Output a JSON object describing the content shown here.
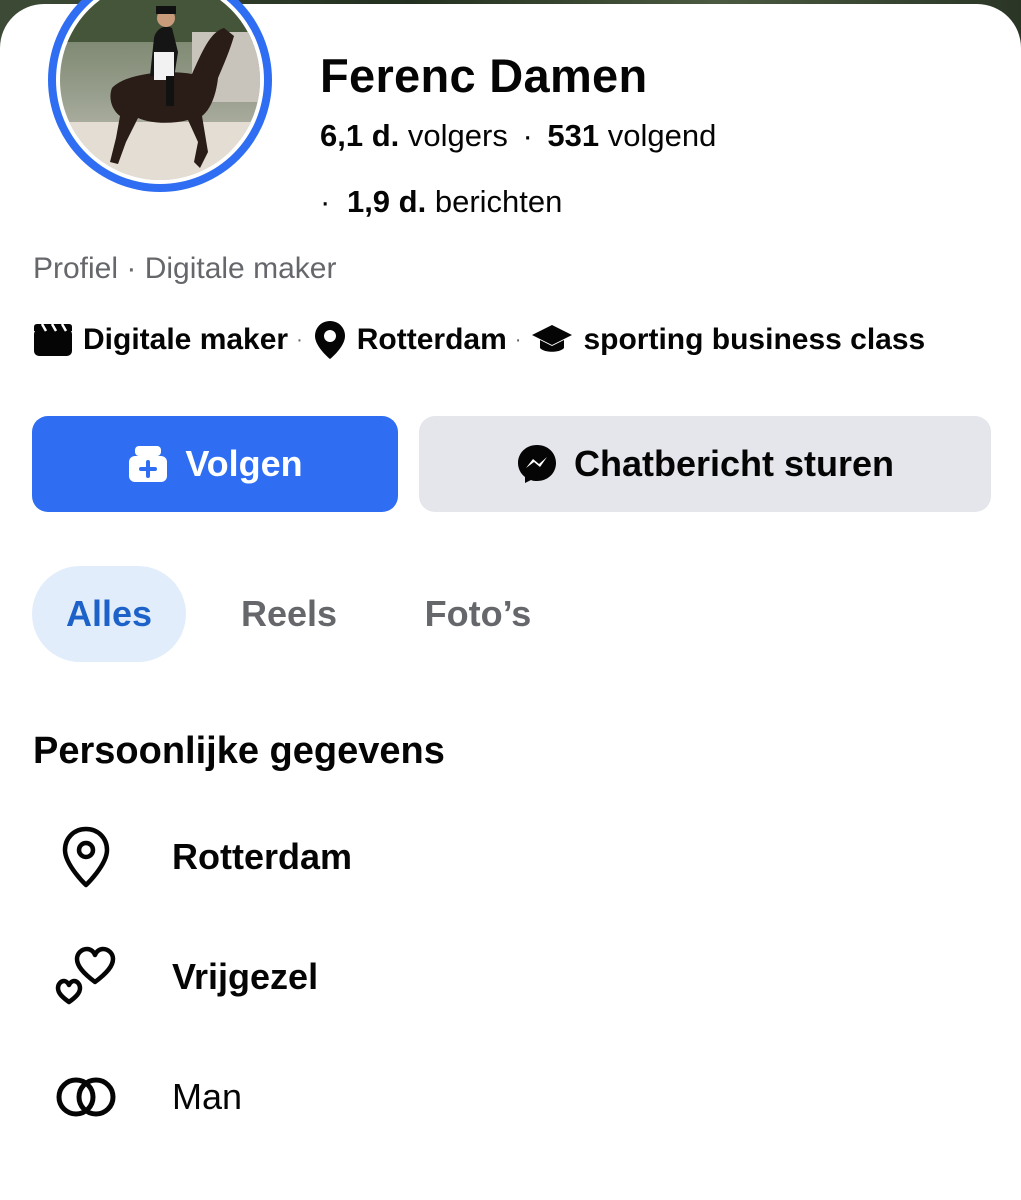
{
  "profile": {
    "name": "Ferenc Damen",
    "followers_count": "6,1 d.",
    "followers_label": "volgers",
    "following_count": "531",
    "following_label": "volgend",
    "posts_count": "1,9 d.",
    "posts_label": "berichten",
    "separator": "·",
    "meta": "Profiel · Digitale maker",
    "avatar_icon": "profile-photo-horse-rider",
    "avatar_ring_color": "#2f6ef2"
  },
  "info": {
    "category": "Digitale maker",
    "category_icon": "clapperboard-icon",
    "location": "Rotterdam",
    "location_icon": "location-pin-icon",
    "education": "sporting business class",
    "education_icon": "graduation-cap-icon",
    "dot": "·"
  },
  "actions": {
    "follow_label": "Volgen",
    "follow_icon": "follow-person-plus-icon",
    "chat_label": "Chatbericht sturen",
    "chat_icon": "messenger-icon",
    "accent": "#2f6ef2"
  },
  "tabs": [
    {
      "label": "Alles",
      "active": true
    },
    {
      "label": "Reels",
      "active": false
    },
    {
      "label": "Foto’s",
      "active": false
    }
  ],
  "personal": {
    "title": "Persoonlijke gegevens",
    "items": [
      {
        "icon": "location-outline-icon",
        "text": "Rotterdam"
      },
      {
        "icon": "hearts-icon",
        "text": "Vrijgezel"
      },
      {
        "icon": "gender-rings-icon",
        "text": "Man"
      }
    ]
  }
}
